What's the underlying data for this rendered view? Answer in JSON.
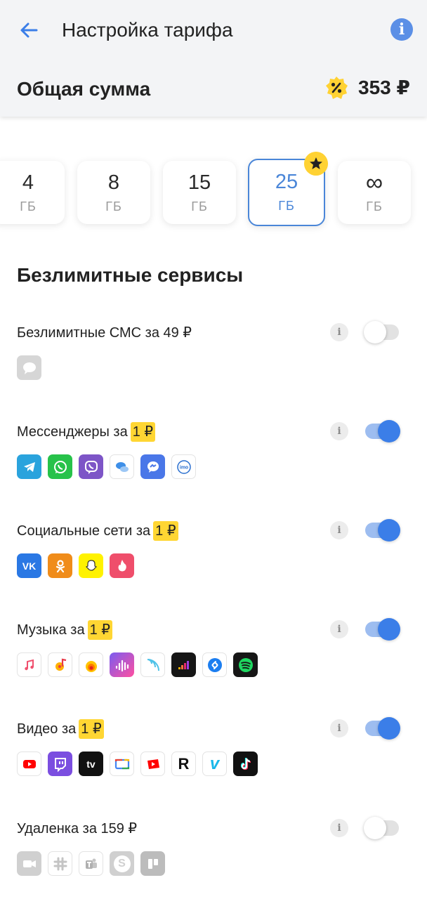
{
  "header": {
    "title": "Настройка тарифа",
    "info_symbol": "i",
    "total_label": "Общая сумма",
    "total_amount": "353 ₽",
    "discount_symbol": "%"
  },
  "gb_options": [
    {
      "value": "4",
      "unit": "ГБ"
    },
    {
      "value": "8",
      "unit": "ГБ"
    },
    {
      "value": "15",
      "unit": "ГБ"
    },
    {
      "value": "25",
      "unit": "ГБ",
      "selected": true
    },
    {
      "value": "∞",
      "unit": "ГБ"
    }
  ],
  "section_title": "Безлимитные сервисы",
  "services": {
    "sms": {
      "label": "Безлимитные СМС за 49 ₽",
      "enabled": false
    },
    "messengers": {
      "label": "Мессенджеры за",
      "price": "1 ₽",
      "enabled": true
    },
    "social": {
      "label": "Социальные сети за",
      "price": "1 ₽",
      "enabled": true
    },
    "music": {
      "label": "Музыка за",
      "price": "1 ₽",
      "enabled": true
    },
    "video": {
      "label": "Видео за",
      "price": "1 ₽",
      "enabled": true
    },
    "remote": {
      "label": "Удаленка за 159 ₽",
      "enabled": false
    }
  },
  "info_symbol": "i",
  "colors": {
    "accent": "#3b7ee8",
    "selected_border": "#4a86d8",
    "price_chip": "#ffd633",
    "header_bg": "#f3f4f6"
  },
  "icons": {
    "messengers": [
      "telegram-icon",
      "whatsapp-icon",
      "viber-icon",
      "chat-bubbles-icon",
      "messenger-icon",
      "imo-icon"
    ],
    "social": [
      "vk-icon",
      "odnoklassniki-icon",
      "snapchat-icon",
      "tinder-icon"
    ],
    "music": [
      "apple-music-icon",
      "music-note-icon",
      "zvuk-icon",
      "sound-waves-icon",
      "podcast-icon",
      "deezer-icon",
      "shazam-icon",
      "spotify-icon"
    ],
    "video": [
      "youtube-icon",
      "twitch-icon",
      "apple-tv-icon",
      "google-tv-icon",
      "youtube-kids-icon",
      "rutube-icon",
      "vimeo-icon",
      "tiktok-icon"
    ],
    "remote": [
      "zoom-icon",
      "slack-icon",
      "teams-icon",
      "skype-icon",
      "trello-icon"
    ]
  },
  "app_text": {
    "imo": "imo",
    "vk": "VK",
    "apple_tv": "tv",
    "rutube": "R",
    "vimeo": "v",
    "skype": "S"
  }
}
